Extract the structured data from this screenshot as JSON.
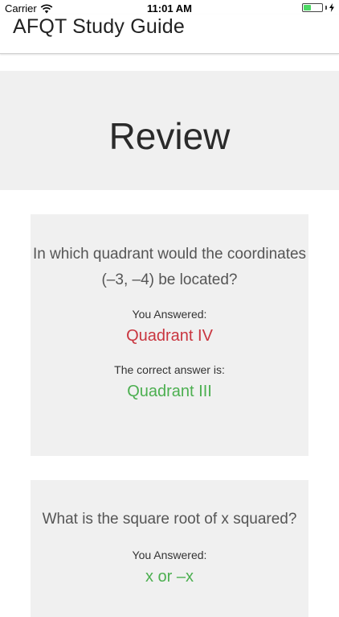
{
  "status_bar": {
    "carrier": "Carrier",
    "time": "11:01 AM",
    "battery_level": 0.4,
    "colors": {
      "battery_fill": "#4cd964"
    },
    "icons": [
      "wifi-icon",
      "battery-icon",
      "charging-icon"
    ]
  },
  "header": {
    "title": "AFQT Study Guide"
  },
  "banner": {
    "title": "Review"
  },
  "questions": [
    {
      "question": "In which quadrant would the coordinates (–3, –4) be located?",
      "you_answered_label": "You Answered:",
      "your_answer": "Quadrant IV",
      "correct_label": "The correct answer is:",
      "correct_answer": "Quadrant III"
    },
    {
      "question": "What is the square root of x squared?",
      "you_answered_label": "You Answered:",
      "your_answer": "x or –x"
    }
  ],
  "colors": {
    "wrong_answer": "#c9353f",
    "correct_answer": "#4caf50",
    "card_background": "#f0f0f0"
  }
}
